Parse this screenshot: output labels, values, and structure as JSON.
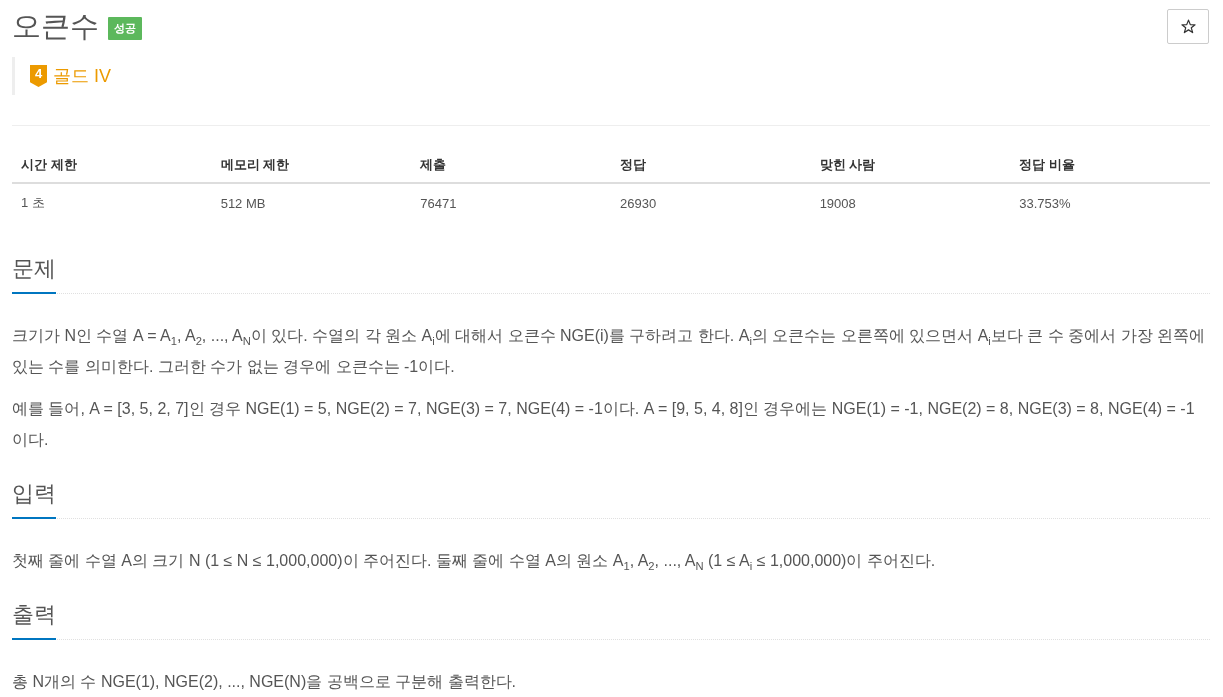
{
  "problem": {
    "title": "오큰수",
    "status_badge": {
      "label": "성공",
      "success": true
    },
    "tier": {
      "badge": "4",
      "label": "골드 IV"
    }
  },
  "stats_table": {
    "columns": [
      "시간 제한",
      "메모리 제한",
      "제출",
      "정답",
      "맞힌 사람",
      "정답 비율"
    ],
    "rows": [
      [
        "1 초",
        "512 MB",
        "76471",
        "26930",
        "19008",
        "33.753%"
      ]
    ]
  },
  "sections": [
    {
      "heading": "문제",
      "paragraphs": [
        "크기가 N인 수열 A = A$_{1}$, A$_{2}$, ..., A$_{N}$이 있다. 수열의 각 원소 A$_{i}$에 대해서 오큰수 NGE(i)를 구하려고 한다. A$_{i}$의 오큰수는 오른쪽에 있으면서 A$_{i}$보다 큰 수 중에서 가장 왼쪽에 있는 수를 의미한다. 그러한 수가 없는 경우에 오큰수는 -1이다.",
        "예를 들어, A = [3, 5, 2, 7]인 경우 NGE(1) = 5, NGE(2) = 7, NGE(3) = 7, NGE(4) = -1이다. A = [9, 5, 4, 8]인 경우에는 NGE(1) = -1, NGE(2) = 8, NGE(3) = 8, NGE(4) = -1이다."
      ]
    },
    {
      "heading": "입력",
      "paragraphs": [
        "첫째 줄에 수열 A의 크기 N (1 ≤ N ≤ 1,000,000)이 주어진다. 둘째 줄에 수열 A의 원소 A$_{1}$, A$_{2}$, ..., A$_{N}$ (1 ≤ A$_{i}$ ≤ 1,000,000)이 주어진다."
      ]
    },
    {
      "heading": "출력",
      "paragraphs": [
        "총 N개의 수 NGE(1), NGE(2), ..., NGE(N)을 공백으로 구분해 출력한다."
      ]
    }
  ]
}
